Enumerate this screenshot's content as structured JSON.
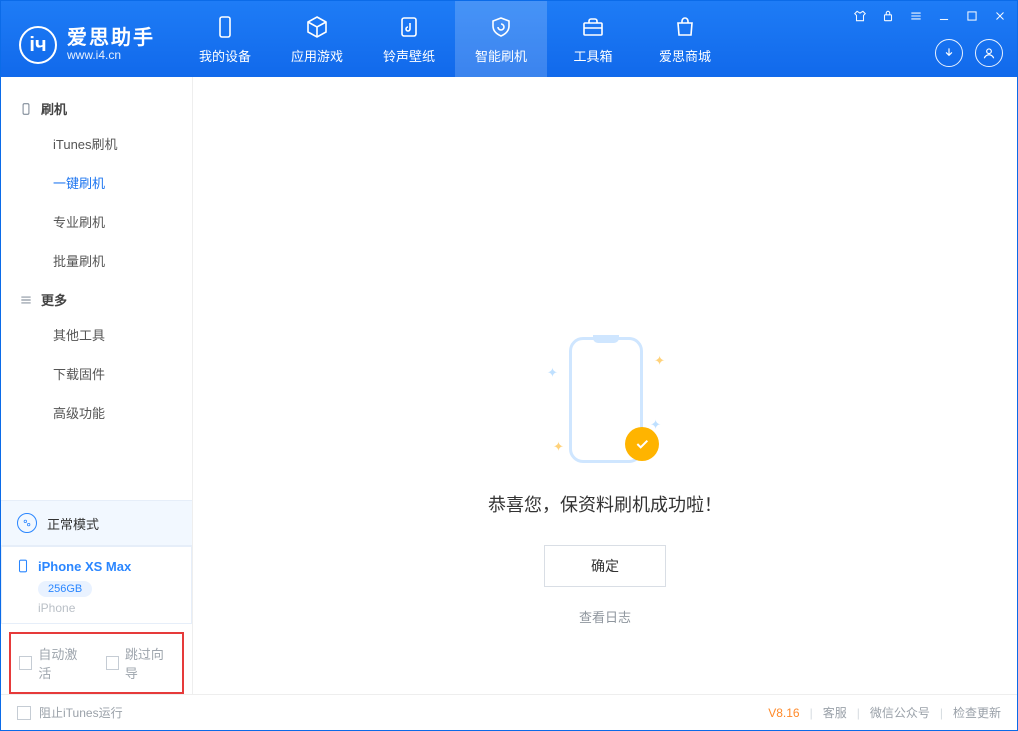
{
  "app": {
    "name": "爱思助手",
    "url": "www.i4.cn"
  },
  "tabs": [
    {
      "label": "我的设备"
    },
    {
      "label": "应用游戏"
    },
    {
      "label": "铃声壁纸"
    },
    {
      "label": "智能刷机"
    },
    {
      "label": "工具箱"
    },
    {
      "label": "爱思商城"
    }
  ],
  "sidebar": {
    "section_flash": "刷机",
    "items_flash": [
      "iTunes刷机",
      "一键刷机",
      "专业刷机",
      "批量刷机"
    ],
    "section_more": "更多",
    "items_more": [
      "其他工具",
      "下载固件",
      "高级功能"
    ]
  },
  "device": {
    "mode": "正常模式",
    "name": "iPhone XS Max",
    "capacity": "256GB",
    "family": "iPhone"
  },
  "options": {
    "auto_activate": "自动激活",
    "skip_guide": "跳过向导"
  },
  "result": {
    "title": "恭喜您，保资料刷机成功啦！",
    "ok": "确定",
    "view_log": "查看日志"
  },
  "status": {
    "block_itunes": "阻止iTunes运行",
    "version": "V8.16",
    "support": "客服",
    "wechat": "微信公众号",
    "update": "检查更新"
  }
}
